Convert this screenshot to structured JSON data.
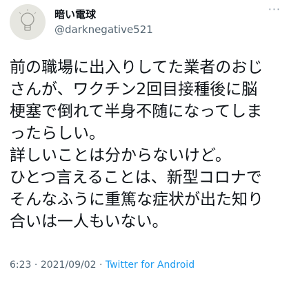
{
  "user": {
    "display_name": "暗い電球",
    "handle": "@darknegative521",
    "avatar_icon": "light-bulb-icon"
  },
  "more_menu": "···",
  "tweet": {
    "lines": [
      "前の職場に出入りしてた業者のおじ",
      "さんが、ワクチン2回目接種後に脳",
      "梗塞で倒れて半身不随になってしま",
      "ったらしい。",
      "詳しいことは分からないけど。",
      "ひとつ言えることは、新型コロナで",
      "そんなふうに重篤な症状が出た知り",
      "合いは一人もいない。"
    ]
  },
  "meta": {
    "time": "6:23",
    "sep1": " · ",
    "date": "2021/09/02",
    "sep2": " · ",
    "source": "Twitter for Android"
  },
  "colors": {
    "link": "#1d9bf0",
    "secondary_text": "#536471",
    "primary_text": "#0f1419"
  }
}
